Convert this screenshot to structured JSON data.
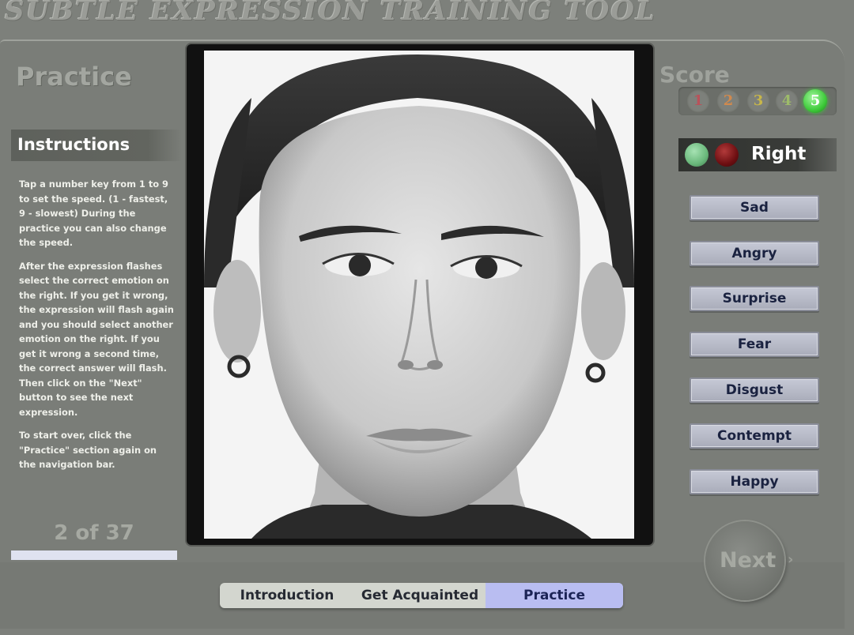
{
  "app": {
    "title": "SUBTLE EXPRESSION TRAINING TOOL"
  },
  "section": {
    "title": "Practice"
  },
  "instructions": {
    "title": "Instructions",
    "paragraphs": [
      "Tap a number key from 1 to 9 to set the speed. (1 - fastest, 9 - slowest) During the practice you can also change the speed.",
      "After the expression flashes select the correct emotion on the right. If you get it wrong, the expression will flash again and you should select another emotion on the right. If you get it wrong a second time, the correct answer will flash. Then click on the \"Next\" button to see the next expression.",
      "To start over, click the \"Practice\" section again on the navigation bar."
    ]
  },
  "progress": {
    "label": "2 of 37",
    "current": 2,
    "total": 37,
    "fill_fraction": 1.0
  },
  "score": {
    "title": "Score",
    "levels": [
      {
        "label": "1",
        "color": "#b9525a",
        "active": false
      },
      {
        "label": "2",
        "color": "#d08a4e",
        "active": false
      },
      {
        "label": "3",
        "color": "#c7b64a",
        "active": false
      },
      {
        "label": "4",
        "color": "#9dbb6a",
        "active": false
      },
      {
        "label": "5",
        "color": "#3ecb3a",
        "active": true
      }
    ]
  },
  "feedback": {
    "text": "Right",
    "green_color": "#6ab87b",
    "red_color": "#6e0f12"
  },
  "emotions": [
    "Sad",
    "Angry",
    "Surprise",
    "Fear",
    "Disgust",
    "Contempt",
    "Happy"
  ],
  "next_button": {
    "label": "Next",
    "arrow": "›"
  },
  "navigation": {
    "tabs": [
      {
        "label": "Introduction",
        "active": false
      },
      {
        "label": "Get Acquainted",
        "active": false
      },
      {
        "label": "Practice",
        "active": true
      }
    ]
  },
  "colors": {
    "panel_bg": "#7a7d78",
    "button_text": "#1a2240",
    "active_tab": "#b9bdf1"
  }
}
